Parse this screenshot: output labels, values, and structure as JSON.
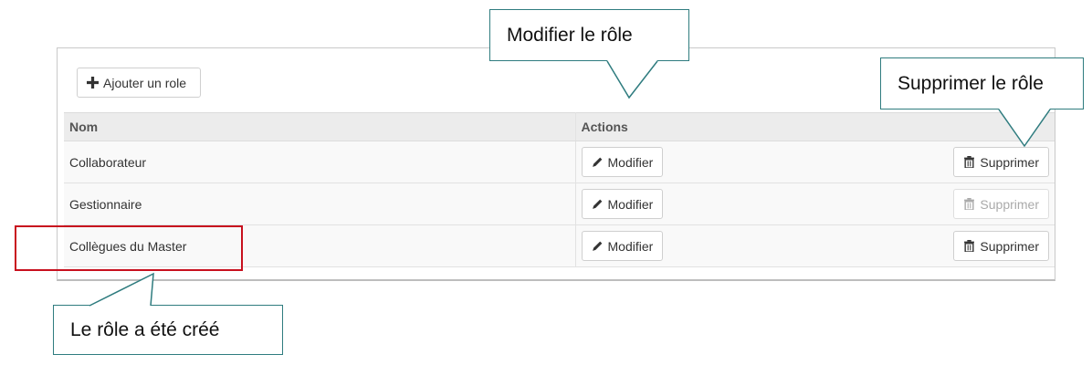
{
  "toolbar": {
    "add_label": "Ajouter un role"
  },
  "table": {
    "headers": {
      "name": "Nom",
      "actions": "Actions"
    },
    "rows": [
      {
        "name": "Collaborateur",
        "edit_label": "Modifier",
        "delete_label": "Supprimer",
        "delete_enabled": true
      },
      {
        "name": "Gestionnaire",
        "edit_label": "Modifier",
        "delete_label": "Supprimer",
        "delete_enabled": false
      },
      {
        "name": "Collègues du Master",
        "edit_label": "Modifier",
        "delete_label": "Supprimer",
        "delete_enabled": true
      }
    ]
  },
  "callouts": {
    "modifier": "Modifier le rôle",
    "supprimer": "Supprimer le rôle",
    "cree": "Le rôle a été créé"
  },
  "colors": {
    "callout_border": "#2f7c7f",
    "highlight": "#c8101e"
  },
  "icons": {
    "add": "plus-icon",
    "edit": "pencil-icon",
    "delete": "trash-icon"
  }
}
